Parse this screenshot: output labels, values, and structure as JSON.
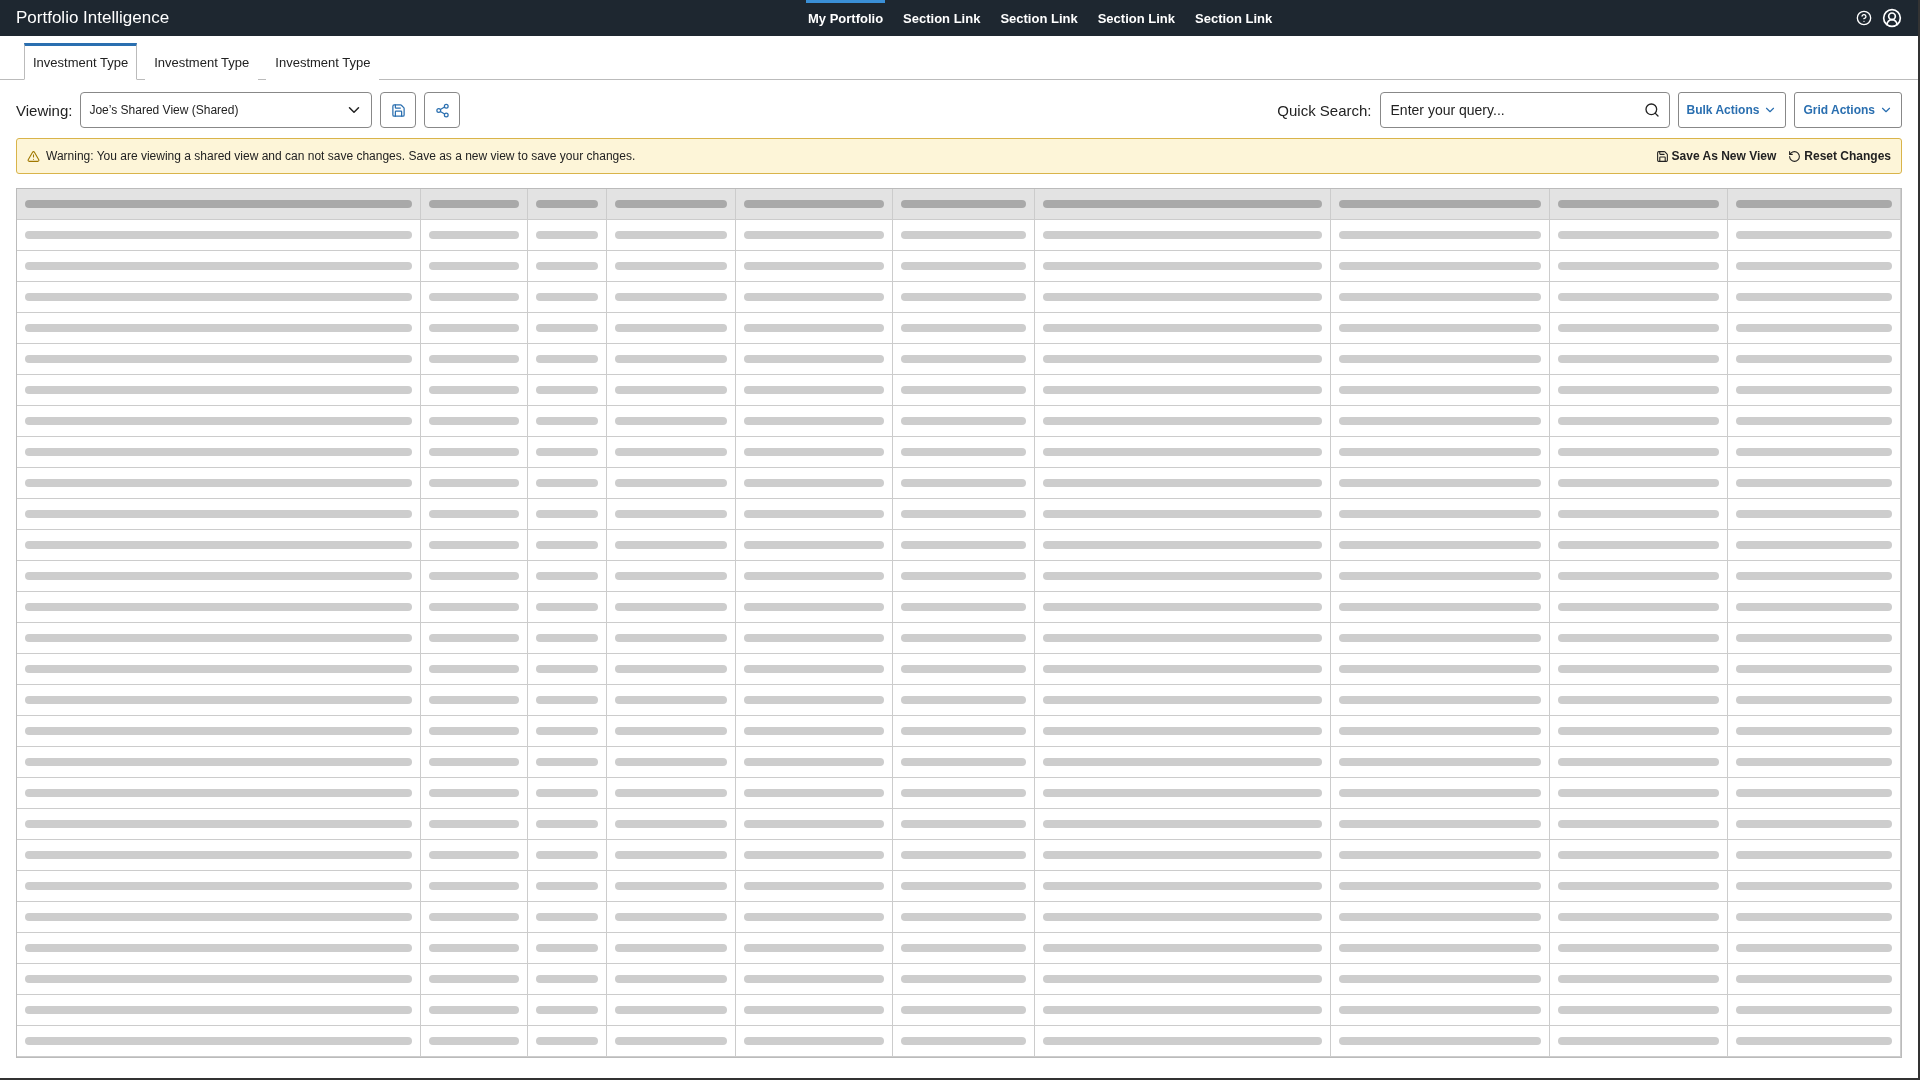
{
  "app_title": "Portfolio Intelligence",
  "nav_links": [
    {
      "label": "My Portfolio",
      "selected": true
    },
    {
      "label": "Section Link",
      "selected": false
    },
    {
      "label": "Section Link",
      "selected": false
    },
    {
      "label": "Section Link",
      "selected": false
    },
    {
      "label": "Section Link",
      "selected": false
    }
  ],
  "tabs": [
    {
      "label": "Investment Type",
      "selected": true
    },
    {
      "label": "Investment Type",
      "selected": false
    },
    {
      "label": "Investment Type",
      "selected": false
    }
  ],
  "viewing": {
    "label": "Viewing:",
    "value": "Joe’s Shared View (Shared)"
  },
  "quick_search": {
    "label": "Quick Search:",
    "placeholder": "Enter your query..."
  },
  "action_buttons": [
    "Bulk Actions",
    "Grid Actions"
  ],
  "warning": {
    "message": "Warning: You are viewing a shared view and can not save changes. Save as a new view to save your changes.",
    "actions": [
      {
        "kind": "save",
        "label": "Save As New View"
      },
      {
        "kind": "reset",
        "label": "Reset Changes"
      }
    ]
  },
  "grid": {
    "loading": true
  }
}
